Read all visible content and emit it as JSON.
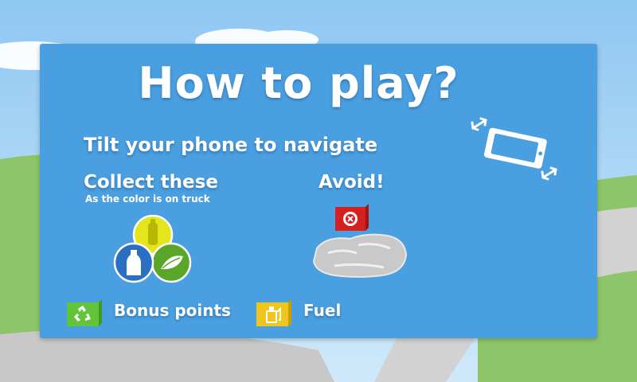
{
  "title": "How to play?",
  "instruction": "Tilt your phone to navigate",
  "collect": {
    "heading": "Collect these",
    "subtext": "As the color is on truck",
    "items": [
      "yellow-bottle-icon",
      "blue-bottle-icon",
      "green-leaf-icon"
    ]
  },
  "avoid": {
    "heading": "Avoid!"
  },
  "legend": {
    "bonus_label": "Bonus points",
    "fuel_label": "Fuel"
  },
  "colors": {
    "panel": "#4a9fe0",
    "sky": "#9fd0f4",
    "yellow": "#e5e51c",
    "blue": "#2a6fc2",
    "green": "#5aa628",
    "red": "#d61f1f",
    "bonus_box": "#62c43a",
    "fuel_box": "#f0c51c"
  }
}
